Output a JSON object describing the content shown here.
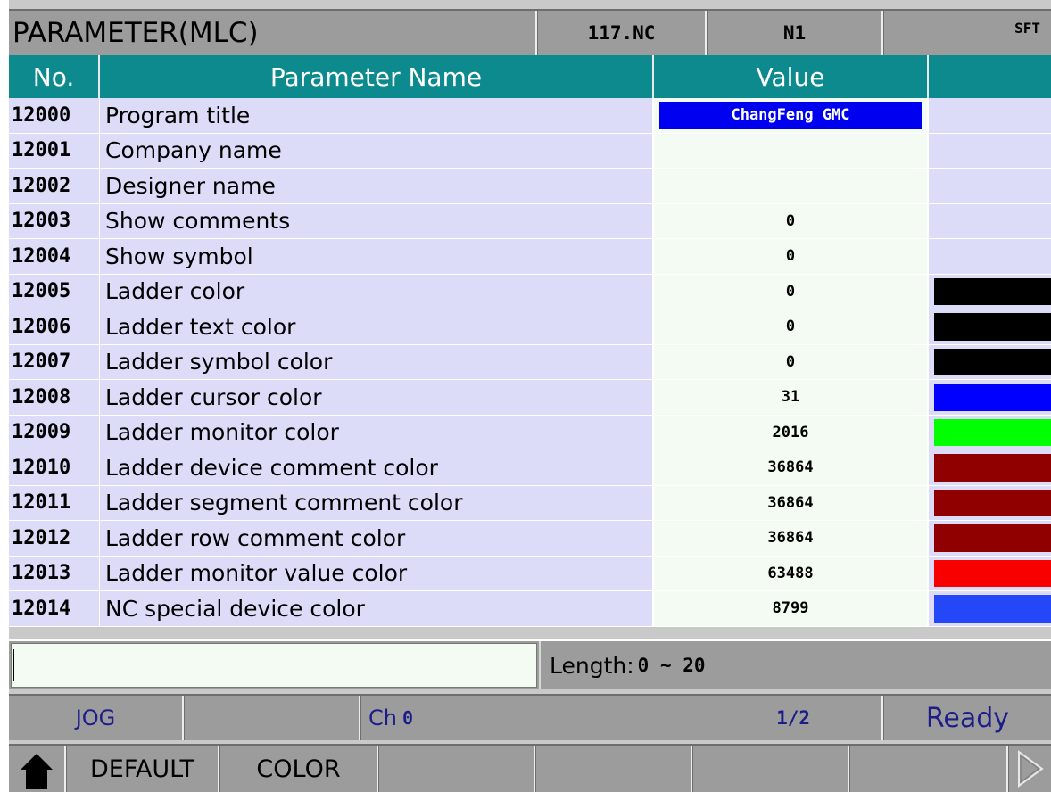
{
  "titlebar": {
    "title": "PARAMETER(MLC)",
    "file": "117.NC",
    "seq": "N1",
    "sft": "SFT"
  },
  "table": {
    "headers": {
      "no": "No.",
      "name": "Parameter Name",
      "value": "Value"
    },
    "rows": [
      {
        "no": "12000",
        "name": "Program title",
        "value": "ChangFeng GMC",
        "selected": true,
        "swatch": null
      },
      {
        "no": "12001",
        "name": "Company name",
        "value": "",
        "swatch": null
      },
      {
        "no": "12002",
        "name": "Designer name",
        "value": "",
        "swatch": null
      },
      {
        "no": "12003",
        "name": "Show comments",
        "value": "0",
        "swatch": null
      },
      {
        "no": "12004",
        "name": "Show symbol",
        "value": "0",
        "swatch": null
      },
      {
        "no": "12005",
        "name": "Ladder color",
        "value": "0",
        "swatch": "#000000"
      },
      {
        "no": "12006",
        "name": "Ladder text color",
        "value": "0",
        "swatch": "#000000"
      },
      {
        "no": "12007",
        "name": "Ladder symbol color",
        "value": "0",
        "swatch": "#000000"
      },
      {
        "no": "12008",
        "name": "Ladder cursor color",
        "value": "31",
        "swatch": "#0000ff"
      },
      {
        "no": "12009",
        "name": "Ladder monitor color",
        "value": "2016",
        "swatch": "#00ff00"
      },
      {
        "no": "12010",
        "name": "Ladder device comment color",
        "value": "36864",
        "swatch": "#900000"
      },
      {
        "no": "12011",
        "name": "Ladder segment comment color",
        "value": "36864",
        "swatch": "#900000"
      },
      {
        "no": "12012",
        "name": "Ladder row comment color",
        "value": "36864",
        "swatch": "#900000"
      },
      {
        "no": "12013",
        "name": "Ladder monitor value color",
        "value": "63488",
        "swatch": "#f80000"
      },
      {
        "no": "12014",
        "name": "NC special device color",
        "value": "8799",
        "swatch": "#2448f8"
      }
    ]
  },
  "inputline": {
    "value": "",
    "length_label": "Length:",
    "length_range": "0 ~ 20"
  },
  "status": {
    "mode": "JOG",
    "channel_label": "Ch",
    "channel_value": "0",
    "page": "1/2",
    "state": "Ready"
  },
  "softkeys": {
    "default": "DEFAULT",
    "color": "COLOR"
  },
  "colors": {
    "header_teal": "#0d8a8e",
    "row_lavender": "#dcdcf8",
    "value_cell": "#f3fbf3",
    "selected_blue": "#0000f0",
    "status_text": "#1d1d8a"
  }
}
